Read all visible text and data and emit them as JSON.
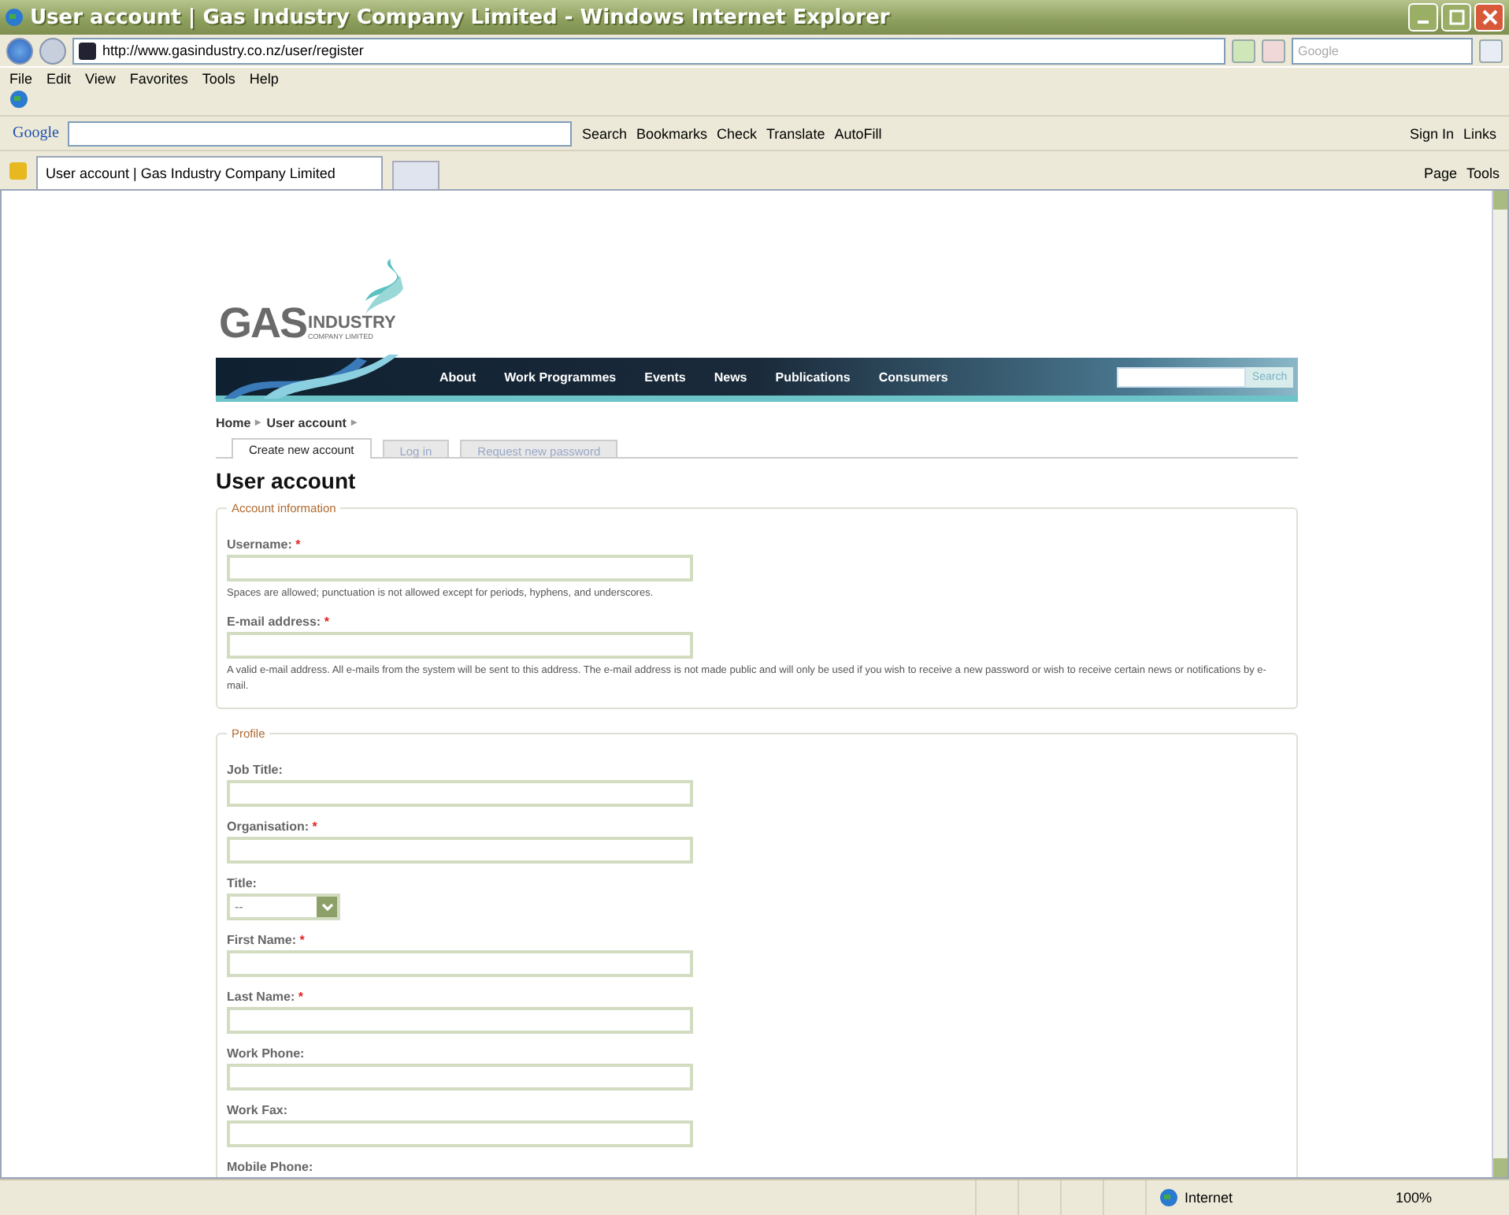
{
  "window": {
    "title": "User account | Gas Industry Company Limited - Windows Internet Explorer"
  },
  "address_bar": {
    "url": "http://www.gasindustry.co.nz/user/register",
    "search_placeholder": "Google"
  },
  "menu": [
    "File",
    "Edit",
    "View",
    "Favorites",
    "Tools",
    "Help"
  ],
  "google_toolbar": {
    "logo": "Google",
    "items": [
      {
        "label": "Search"
      },
      {
        "label": "Bookmarks"
      },
      {
        "label": "Check"
      },
      {
        "label": "Translate"
      },
      {
        "label": "AutoFill"
      }
    ],
    "right": [
      {
        "label": "Sign In"
      },
      {
        "label": "Links"
      }
    ]
  },
  "browser_tab": {
    "title": "User account | Gas Industry Company Limited"
  },
  "command_bar": [
    {
      "label": "Page"
    },
    {
      "label": "Tools"
    }
  ],
  "page": {
    "logo": {
      "main": "GAS",
      "word": "INDUSTRY",
      "sub": "COMPANY LIMITED"
    },
    "nav": [
      "About",
      "Work Programmes",
      "Events",
      "News",
      "Publications",
      "Consumers"
    ],
    "nav_search_button": "Search",
    "breadcrumb": {
      "items": [
        "Home",
        "User account"
      ],
      "separator": "▸"
    },
    "tabs": [
      {
        "label": "Create new account",
        "selected": true
      },
      {
        "label": "Log in",
        "selected": false
      },
      {
        "label": "Request new password",
        "selected": false
      }
    ],
    "heading": "User account",
    "required_mark": "*",
    "fieldsets": [
      {
        "legend": "Account information",
        "fields": [
          {
            "kind": "text",
            "label": "Username:",
            "required": true,
            "description": "Spaces are allowed; punctuation is not allowed except for periods, hyphens, and underscores."
          },
          {
            "kind": "text",
            "label": "E-mail address:",
            "required": true,
            "description": "A valid e-mail address. All e-mails from the system will be sent to this address. The e-mail address is not made public and will only be used if you wish to receive a new password or wish to receive certain news or notifications by e-mail."
          }
        ]
      },
      {
        "legend": "Profile",
        "fields": [
          {
            "kind": "text",
            "label": "Job Title:",
            "required": false
          },
          {
            "kind": "text",
            "label": "Organisation:",
            "required": true
          },
          {
            "kind": "select",
            "label": "Title:",
            "required": false,
            "value": "--"
          },
          {
            "kind": "text",
            "label": "First Name:",
            "required": true
          },
          {
            "kind": "text",
            "label": "Last Name:",
            "required": true
          },
          {
            "kind": "text",
            "label": "Work Phone:",
            "required": false
          },
          {
            "kind": "text",
            "label": "Work Fax:",
            "required": false
          },
          {
            "kind": "label",
            "label": "Mobile Phone:",
            "required": false
          }
        ]
      }
    ]
  },
  "status_bar": {
    "zone": "Internet",
    "zoom": "100%"
  }
}
